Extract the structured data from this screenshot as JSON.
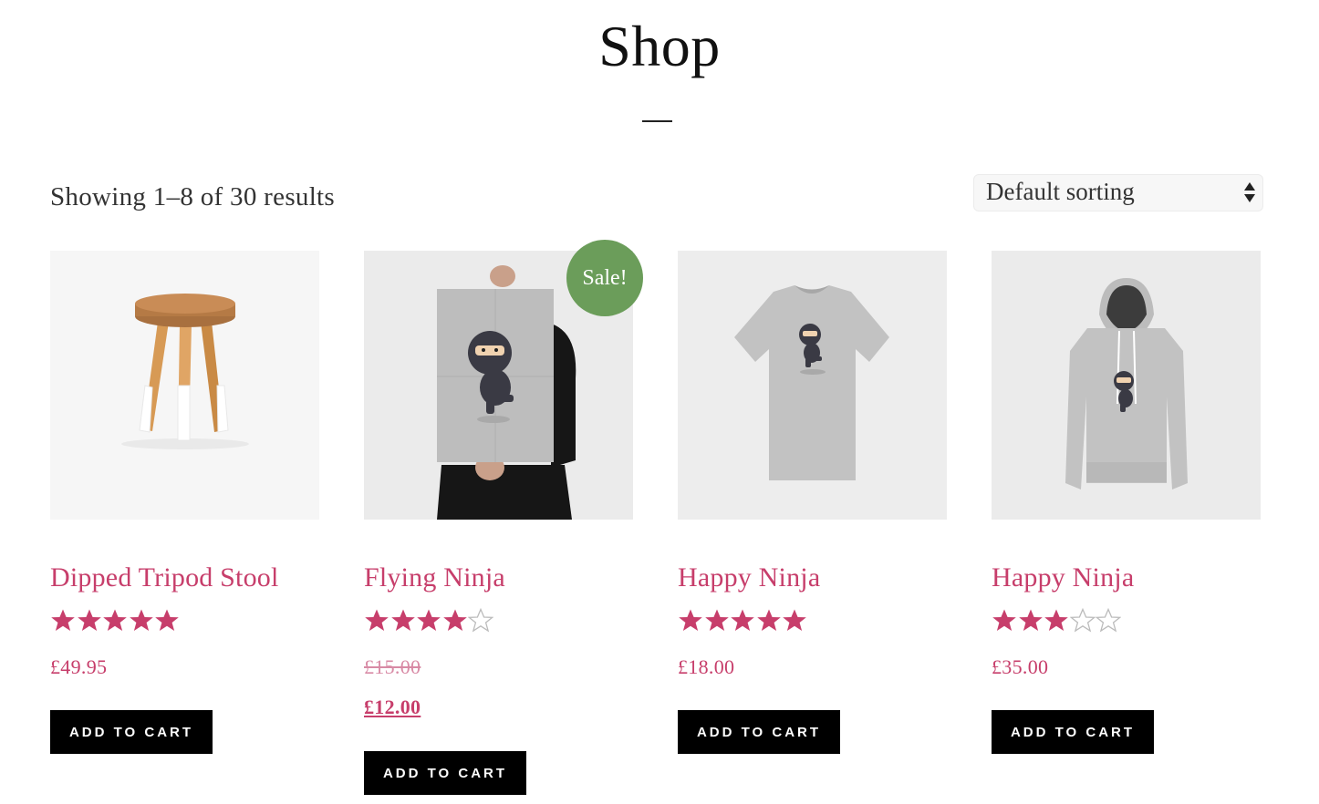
{
  "page": {
    "title": "Shop"
  },
  "results": {
    "count_text": "Showing 1–8 of 30 results"
  },
  "sorting": {
    "selected": "Default sorting"
  },
  "colors": {
    "accent": "#c73e6b",
    "sale": "#6b9d5a",
    "button": "#000000",
    "star_empty": "#bbbbbb"
  },
  "products": [
    {
      "name": "Dipped Tripod Stool",
      "rating": 5,
      "price": "£49.95",
      "button_label": "ADD TO CART",
      "image": "stool-image"
    },
    {
      "name": "Flying Ninja",
      "rating": 4,
      "sale_badge": "Sale!",
      "old_price": "£15.00",
      "price": "£12.00",
      "button_label": "ADD TO CART",
      "image": "poster-image"
    },
    {
      "name": "Happy Ninja",
      "rating": 5,
      "price": "£18.00",
      "button_label": "ADD TO CART",
      "image": "tshirt-image"
    },
    {
      "name": "Happy Ninja",
      "rating": 3,
      "price": "£35.00",
      "button_label": "ADD TO CART",
      "image": "hoodie-image"
    }
  ]
}
